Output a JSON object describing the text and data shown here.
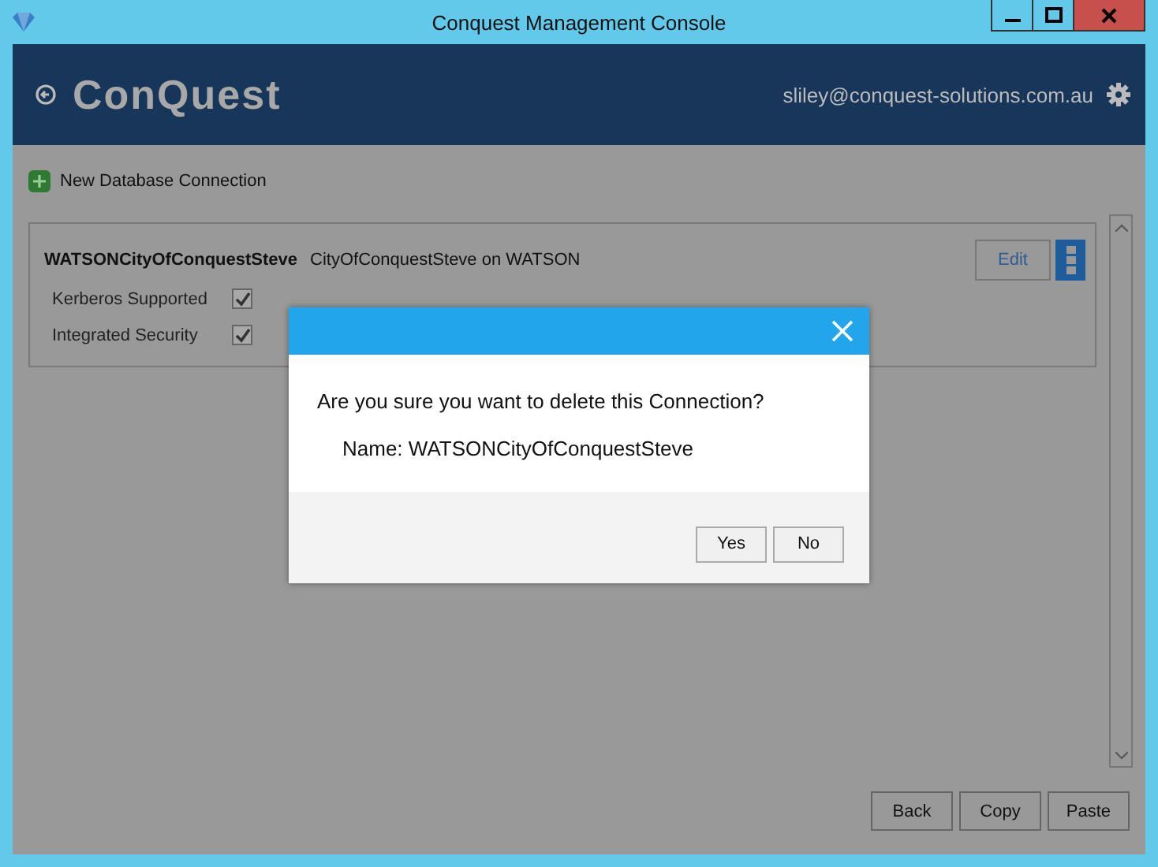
{
  "window": {
    "title": "Conquest Management Console"
  },
  "header": {
    "logo": "ConQuest",
    "user": "sliley@conquest-solutions.com.au"
  },
  "new_connection": {
    "label": "New Database Connection"
  },
  "connections": [
    {
      "name": "WATSONCityOfConquestSteve",
      "description": "CityOfConquestSteve on WATSON",
      "edit": "Edit",
      "options": [
        {
          "label": "Kerberos Supported",
          "checked": true
        },
        {
          "label": "Integrated Security",
          "checked": true
        }
      ]
    }
  ],
  "footer_buttons": [
    "Back",
    "Copy",
    "Paste"
  ],
  "dialog": {
    "message": "Are you sure you want to delete this Connection?",
    "detail": "Name: WATSONCityOfConquestSteve",
    "buttons": [
      "Yes",
      "No"
    ]
  }
}
